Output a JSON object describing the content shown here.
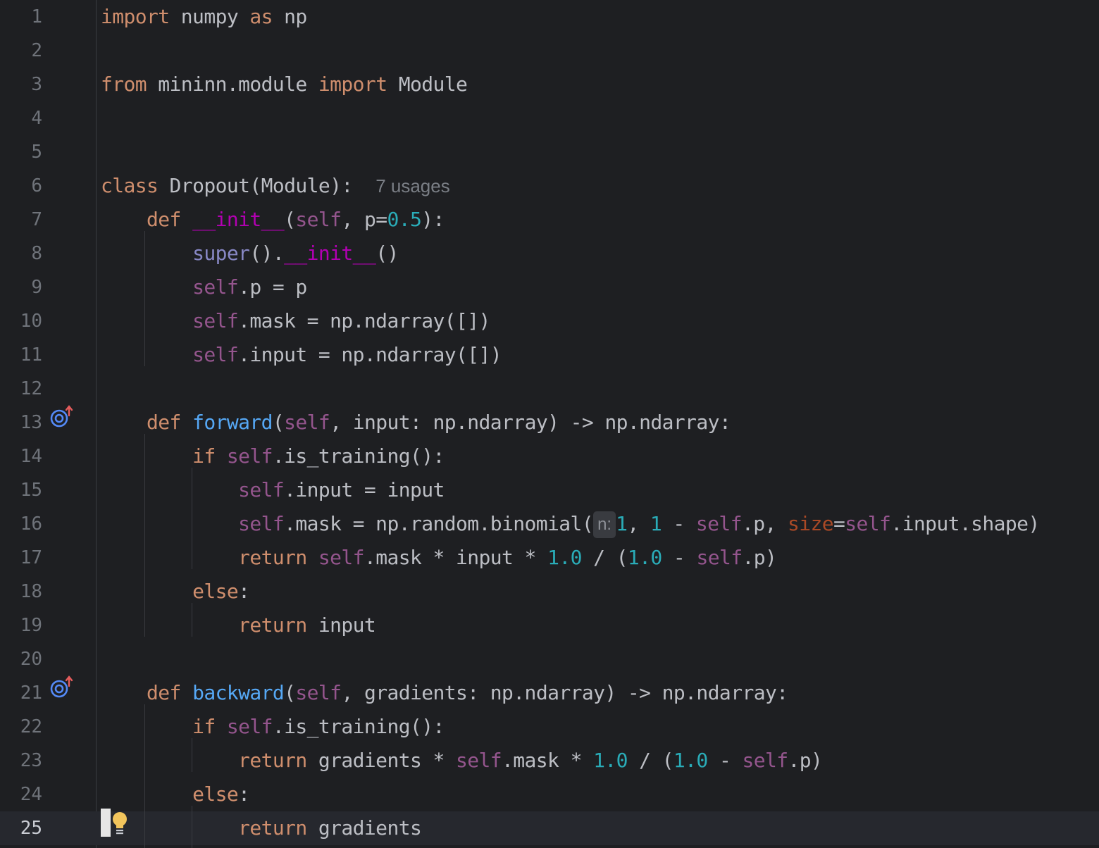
{
  "editor": {
    "lines": [
      {
        "n": "1",
        "t": [
          [
            "kw",
            "import"
          ],
          [
            "p",
            " numpy "
          ],
          [
            "kw",
            "as"
          ],
          [
            "p",
            " np"
          ]
        ]
      },
      {
        "n": "2",
        "t": []
      },
      {
        "n": "3",
        "t": [
          [
            "kw",
            "from"
          ],
          [
            "p",
            " mininn.module "
          ],
          [
            "kw",
            "import"
          ],
          [
            "p",
            " Module"
          ]
        ]
      },
      {
        "n": "4",
        "t": []
      },
      {
        "n": "5",
        "t": []
      },
      {
        "n": "6",
        "t": [
          [
            "kw",
            "class"
          ],
          [
            "p",
            " Dropout(Module):  "
          ],
          [
            "usages",
            "7 usages"
          ]
        ]
      },
      {
        "n": "7",
        "t": [
          [
            "p",
            "    "
          ],
          [
            "kw",
            "def"
          ],
          [
            "p",
            " "
          ],
          [
            "dunder",
            "__init__"
          ],
          [
            "p",
            "("
          ],
          [
            "selfc",
            "self"
          ],
          [
            "p",
            ", p="
          ],
          [
            "num",
            "0.5"
          ],
          [
            "p",
            "):"
          ]
        ]
      },
      {
        "n": "8",
        "t": [
          [
            "p",
            "        "
          ],
          [
            "builtin",
            "super"
          ],
          [
            "p",
            "()."
          ],
          [
            "dunder",
            "__init__"
          ],
          [
            "p",
            "()"
          ]
        ]
      },
      {
        "n": "9",
        "t": [
          [
            "p",
            "        "
          ],
          [
            "selfc",
            "self"
          ],
          [
            "p",
            ".p = p"
          ]
        ]
      },
      {
        "n": "10",
        "t": [
          [
            "p",
            "        "
          ],
          [
            "selfc",
            "self"
          ],
          [
            "p",
            ".mask = np.ndarray([])"
          ]
        ]
      },
      {
        "n": "11",
        "t": [
          [
            "p",
            "        "
          ],
          [
            "selfc",
            "self"
          ],
          [
            "p",
            ".input = np.ndarray([])"
          ]
        ]
      },
      {
        "n": "12",
        "t": []
      },
      {
        "n": "13",
        "t": [
          [
            "p",
            "    "
          ],
          [
            "kw",
            "def"
          ],
          [
            "p",
            " "
          ],
          [
            "fn",
            "forward"
          ],
          [
            "p",
            "("
          ],
          [
            "selfc",
            "self"
          ],
          [
            "p",
            ", input: np.ndarray) -> np.ndarray:"
          ]
        ]
      },
      {
        "n": "14",
        "t": [
          [
            "p",
            "        "
          ],
          [
            "kw",
            "if"
          ],
          [
            "p",
            " "
          ],
          [
            "selfc",
            "self"
          ],
          [
            "p",
            ".is_training():"
          ]
        ]
      },
      {
        "n": "15",
        "t": [
          [
            "p",
            "            "
          ],
          [
            "selfc",
            "self"
          ],
          [
            "p",
            ".input = input"
          ]
        ]
      },
      {
        "n": "16",
        "t": [
          [
            "p",
            "            "
          ],
          [
            "selfc",
            "self"
          ],
          [
            "p",
            ".mask = np.random.binomial("
          ],
          [
            "inlay",
            "n:"
          ],
          [
            "num",
            "1"
          ],
          [
            "p",
            ", "
          ],
          [
            "num",
            "1"
          ],
          [
            "p",
            " - "
          ],
          [
            "selfc",
            "self"
          ],
          [
            "p",
            ".p, "
          ],
          [
            "param",
            "size"
          ],
          [
            "p",
            "="
          ],
          [
            "selfc",
            "self"
          ],
          [
            "p",
            ".input.shape)"
          ]
        ]
      },
      {
        "n": "17",
        "t": [
          [
            "p",
            "            "
          ],
          [
            "kw",
            "return"
          ],
          [
            "p",
            " "
          ],
          [
            "selfc",
            "self"
          ],
          [
            "p",
            ".mask * input * "
          ],
          [
            "num",
            "1.0"
          ],
          [
            "p",
            " / ("
          ],
          [
            "num",
            "1.0"
          ],
          [
            "p",
            " - "
          ],
          [
            "selfc",
            "self"
          ],
          [
            "p",
            ".p)"
          ]
        ]
      },
      {
        "n": "18",
        "t": [
          [
            "p",
            "        "
          ],
          [
            "kw",
            "else"
          ],
          [
            "p",
            ":"
          ]
        ]
      },
      {
        "n": "19",
        "t": [
          [
            "p",
            "            "
          ],
          [
            "kw",
            "return"
          ],
          [
            "p",
            " input"
          ]
        ]
      },
      {
        "n": "20",
        "t": []
      },
      {
        "n": "21",
        "t": [
          [
            "p",
            "    "
          ],
          [
            "kw",
            "def"
          ],
          [
            "p",
            " "
          ],
          [
            "fn",
            "backward"
          ],
          [
            "p",
            "("
          ],
          [
            "selfc",
            "self"
          ],
          [
            "p",
            ", gradients: np.ndarray) -> np.ndarray:"
          ]
        ]
      },
      {
        "n": "22",
        "t": [
          [
            "p",
            "        "
          ],
          [
            "kw",
            "if"
          ],
          [
            "p",
            " "
          ],
          [
            "selfc",
            "self"
          ],
          [
            "p",
            ".is_training():"
          ]
        ]
      },
      {
        "n": "23",
        "t": [
          [
            "p",
            "            "
          ],
          [
            "kw",
            "return"
          ],
          [
            "p",
            " gradients * "
          ],
          [
            "selfc",
            "self"
          ],
          [
            "p",
            ".mask * "
          ],
          [
            "num",
            "1.0"
          ],
          [
            "p",
            " / ("
          ],
          [
            "num",
            "1.0"
          ],
          [
            "p",
            " - "
          ],
          [
            "selfc",
            "self"
          ],
          [
            "p",
            ".p)"
          ]
        ]
      },
      {
        "n": "24",
        "t": [
          [
            "p",
            "        "
          ],
          [
            "kw",
            "else"
          ],
          [
            "p",
            ":"
          ]
        ]
      },
      {
        "n": "25",
        "t": [
          [
            "p",
            "            "
          ],
          [
            "kw",
            "return"
          ],
          [
            "p",
            " gradients"
          ]
        ]
      }
    ],
    "current_line": "25",
    "override_gutter_lines": [
      "13",
      "21"
    ],
    "colors": {
      "background": "#1e1f22",
      "current_line": "#26282e",
      "keyword": "#cf8e6d",
      "self": "#94558d",
      "number": "#2aacb8",
      "function": "#56a8f5",
      "dunder": "#b200b2",
      "builtin": "#8888c6",
      "named_param": "#aa4926",
      "override_icon": "#548af7",
      "override_arrow": "#e55c5c",
      "bulb": "#f2c55c"
    },
    "icons": {
      "override": "overrides-method-icon",
      "intention": "lightbulb-icon"
    }
  }
}
